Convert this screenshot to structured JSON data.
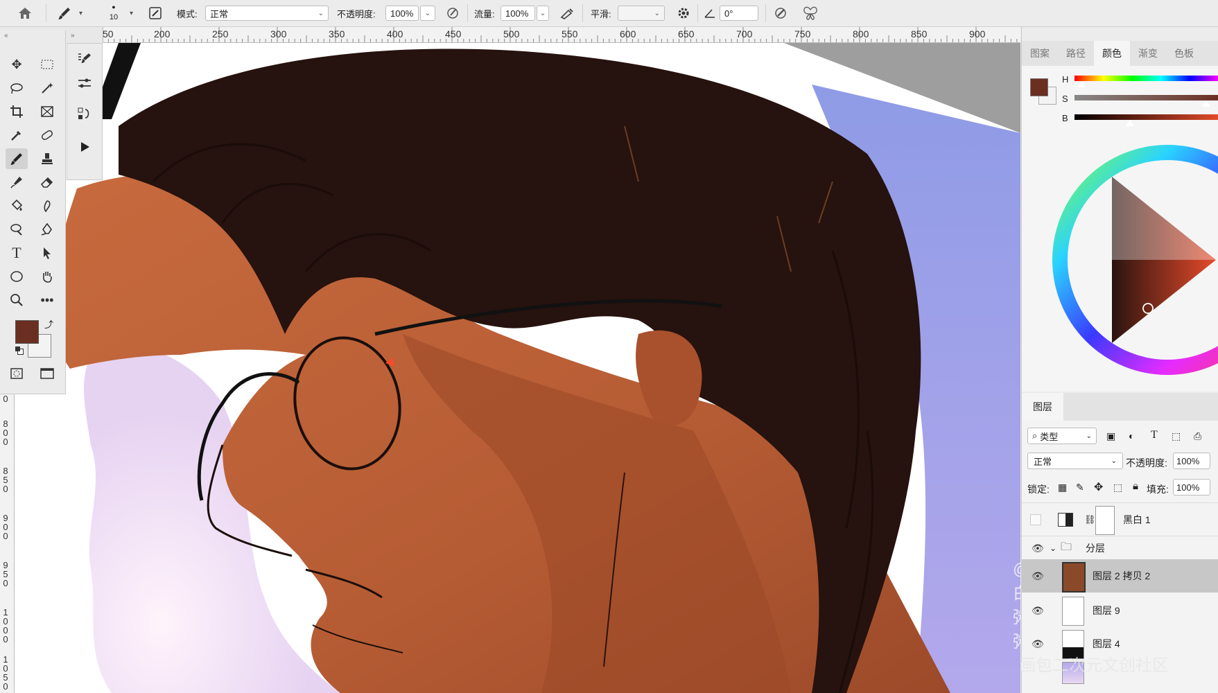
{
  "options_bar": {
    "brush_size": "10",
    "mode_label": "模式:",
    "mode_value": "正常",
    "opacity_label": "不透明度:",
    "opacity_value": "100%",
    "flow_label": "流量:",
    "flow_value": "100%",
    "smoothing_label": "平滑:",
    "smoothing_value": "",
    "angle_value": "0°"
  },
  "ruler_top": [
    "50",
    "200",
    "250",
    "300",
    "350",
    "400",
    "450",
    "500",
    "550",
    "600",
    "650",
    "700",
    "750",
    "800",
    "850",
    "900"
  ],
  "ruler_left": [
    "0",
    "800",
    "850",
    "900",
    "950",
    "1000",
    "1050"
  ],
  "colors": {
    "foreground": "#6b2f22",
    "background": "#f3f3f3",
    "accent_selected_layer": "#c7c7c7"
  },
  "color_panel": {
    "tabs": [
      "图案",
      "路径",
      "颜色",
      "渐变",
      "色板"
    ],
    "active_tab": "颜色",
    "h_label": "H",
    "s_label": "S",
    "b_label": "B"
  },
  "layers_panel": {
    "tab": "图层",
    "filter_label": "类型",
    "blend_mode": "正常",
    "opacity_label": "不透明度:",
    "opacity_value": "100%",
    "lock_label": "锁定:",
    "fill_label": "填充:",
    "fill_value": "100%",
    "layers": [
      {
        "name": "黑白 1",
        "visible": false,
        "type": "adjustment"
      },
      {
        "name": "分层",
        "visible": true,
        "type": "group"
      },
      {
        "name": "图层 2 拷贝 2",
        "visible": true,
        "type": "pixel",
        "selected": true
      },
      {
        "name": "图层 9",
        "visible": true,
        "type": "pixel"
      },
      {
        "name": "图层 4",
        "visible": true,
        "type": "pixel"
      }
    ]
  },
  "watermark": {
    "line1": "@白粥粥",
    "line2": "画包二次元文创社区"
  }
}
